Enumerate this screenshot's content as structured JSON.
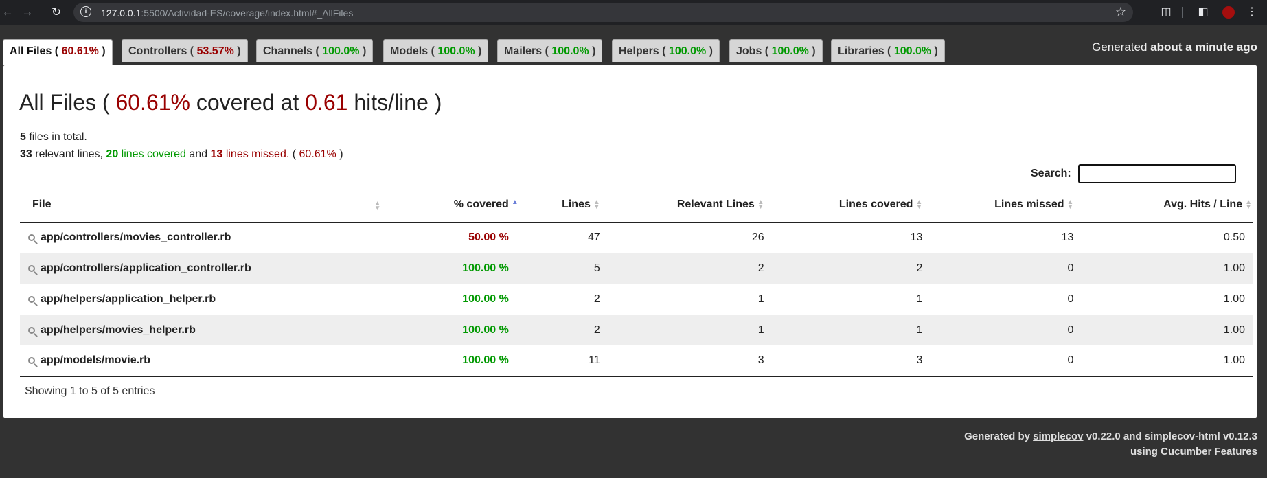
{
  "browser": {
    "url_host": "127.0.0.1",
    "url_rest": ":5500/Actividad-ES/coverage/index.html#_AllFiles"
  },
  "tabs": [
    {
      "label": "All Files",
      "pct": "60.61%",
      "level": "red",
      "active": true
    },
    {
      "label": "Controllers",
      "pct": "53.57%",
      "level": "red",
      "active": false
    },
    {
      "label": "Channels",
      "pct": "100.0%",
      "level": "green",
      "active": false
    },
    {
      "label": "Models",
      "pct": "100.0%",
      "level": "green",
      "active": false
    },
    {
      "label": "Mailers",
      "pct": "100.0%",
      "level": "green",
      "active": false
    },
    {
      "label": "Helpers",
      "pct": "100.0%",
      "level": "green",
      "active": false
    },
    {
      "label": "Jobs",
      "pct": "100.0%",
      "level": "green",
      "active": false
    },
    {
      "label": "Libraries",
      "pct": "100.0%",
      "level": "green",
      "active": false
    }
  ],
  "generated": {
    "prefix": "Generated",
    "when": "about a minute ago"
  },
  "heading": {
    "name": "All Files",
    "pct": "60.61%",
    "mid": "covered at",
    "hits": "0.61",
    "suffix": "hits/line"
  },
  "summary": {
    "files_count": "5",
    "files_text": "files in total.",
    "relevant": "33",
    "relevant_text": "relevant lines,",
    "covered": "20",
    "covered_text": "lines covered",
    "and_text": "and",
    "missed": "13",
    "missed_text": "lines missed.",
    "pct": "60.61%"
  },
  "search": {
    "label": "Search:",
    "value": ""
  },
  "table": {
    "headers": [
      "File",
      "% covered",
      "Lines",
      "Relevant Lines",
      "Lines covered",
      "Lines missed",
      "Avg. Hits / Line"
    ],
    "rows": [
      {
        "file": "app/controllers/movies_controller.rb",
        "pct": "50.00 %",
        "level": "red",
        "lines": "47",
        "relevant": "26",
        "covered": "13",
        "missed": "13",
        "avg": "0.50"
      },
      {
        "file": "app/controllers/application_controller.rb",
        "pct": "100.00 %",
        "level": "green",
        "lines": "5",
        "relevant": "2",
        "covered": "2",
        "missed": "0",
        "avg": "1.00"
      },
      {
        "file": "app/helpers/application_helper.rb",
        "pct": "100.00 %",
        "level": "green",
        "lines": "2",
        "relevant": "1",
        "covered": "1",
        "missed": "0",
        "avg": "1.00"
      },
      {
        "file": "app/helpers/movies_helper.rb",
        "pct": "100.00 %",
        "level": "green",
        "lines": "2",
        "relevant": "1",
        "covered": "1",
        "missed": "0",
        "avg": "1.00"
      },
      {
        "file": "app/models/movie.rb",
        "pct": "100.00 %",
        "level": "green",
        "lines": "11",
        "relevant": "3",
        "covered": "3",
        "missed": "0",
        "avg": "1.00"
      }
    ]
  },
  "entries_info": "Showing 1 to 5 of 5 entries",
  "footer": {
    "prefix": "Generated by",
    "link": "simplecov",
    "version": "v0.22.0 and simplecov-html v0.12.3",
    "line2": "using Cucumber Features"
  },
  "colors": {
    "green": "#009900",
    "red": "#990000",
    "background": "#323232"
  }
}
